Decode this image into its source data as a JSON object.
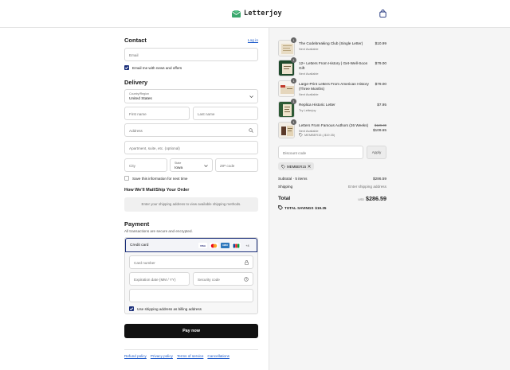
{
  "brand": {
    "name": "Letterjoy"
  },
  "contact": {
    "title": "Contact",
    "login_link": "Log in",
    "email_placeholder": "Email",
    "news_label": "Email me with news and offers"
  },
  "delivery": {
    "title": "Delivery",
    "country_label": "Country/Region",
    "country_value": "United States",
    "first_name_placeholder": "First name",
    "last_name_placeholder": "Last name",
    "address_placeholder": "Address",
    "apartment_placeholder": "Apartment, suite, etc. (optional)",
    "city_placeholder": "City",
    "state_label": "State",
    "state_value": "Iowa",
    "zip_placeholder": "ZIP code",
    "save_info_label": "Save this information for next time"
  },
  "shipping": {
    "title": "How We'll Mail/Ship Your Order",
    "message": "Enter your shipping address to view available shipping methods."
  },
  "payment": {
    "title": "Payment",
    "secure_note": "All transactions are secure and encrypted.",
    "method_label": "Credit card",
    "cards": [
      "VISA",
      "MC",
      "AMEX",
      "JCB"
    ],
    "more_cards": "+4",
    "card_number_placeholder": "Card number",
    "expiry_placeholder": "Expiration date (MM / YY)",
    "security_placeholder": "Security code",
    "billing_label": "Use shipping address as billing address",
    "pay_button": "Pay now"
  },
  "footer": {
    "links": [
      "Refund policy",
      "Privacy policy",
      "Terms of service",
      "Cancellations"
    ]
  },
  "order": {
    "items": [
      {
        "qty": "1",
        "name": "The Codebreaking Club (Single Letter)",
        "sub": "Next Available",
        "price": "$10.99"
      },
      {
        "qty": "1",
        "name": "12+ Letters From History | Get-Well-Soon Gift",
        "sub": "Next Available",
        "price": "$79.00"
      },
      {
        "qty": "1",
        "name": "Large-Print Letters From American History (Three Months)",
        "sub": "Next Available",
        "price": "$79.00"
      },
      {
        "qty": "1",
        "name": "Replica Historic Letter",
        "sub": "Try Letterjoy",
        "price": "$7.95"
      },
      {
        "qty": "1",
        "name": "Letters From Famous Authors (26 Weeks)",
        "sub": "Next Available",
        "discount": "MEMBER15 (-$19.35)",
        "old_price": "$129.00",
        "price": "$109.65"
      }
    ],
    "discount_placeholder": "Discount code",
    "apply_button": "Apply",
    "applied_code": "MEMBER15",
    "subtotal_label": "Subtotal · 5 items",
    "subtotal_value": "$286.59",
    "shipping_label": "Shipping",
    "shipping_value": "Enter shipping address",
    "total_label": "Total",
    "total_currency": "USD",
    "total_value": "$286.59",
    "savings_label": "TOTAL SAVINGS",
    "savings_value": "$19.35"
  },
  "colors": {
    "accent": "#1b2f7a",
    "link": "#1a58c9",
    "button": "#111111",
    "logo_green": "#3aa76d"
  }
}
